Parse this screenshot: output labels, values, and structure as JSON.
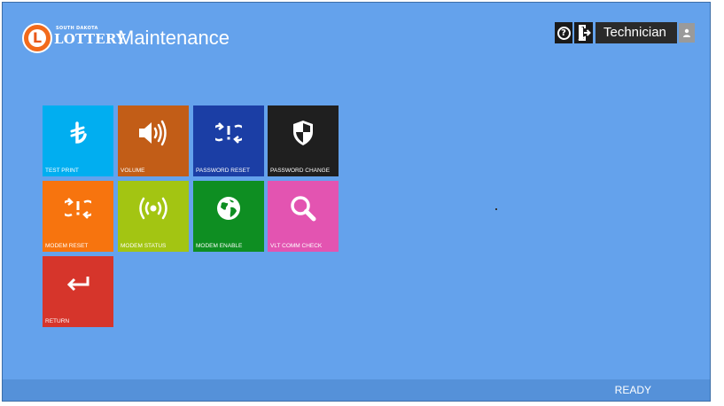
{
  "header": {
    "logo": {
      "sub": "SOUTH DAKOTA",
      "main": "LOTTERY",
      "letter": "L"
    },
    "title": "Maintenance",
    "user": "Technician"
  },
  "tiles": [
    {
      "label": "TEST PRINT",
      "icon": "test-print-icon",
      "color": "#01aef0"
    },
    {
      "label": "VOLUME",
      "icon": "speaker-icon",
      "color": "#c25d17"
    },
    {
      "label": "PASSWORD RESET",
      "icon": "reset-icon",
      "color": "#1b3ea5"
    },
    {
      "label": "PASSWORD CHANGE",
      "icon": "shield-icon",
      "color": "#1f1f1f"
    },
    {
      "label": "MODEM RESET",
      "icon": "reset-icon",
      "color": "#f7740e"
    },
    {
      "label": "MODEM STATUS",
      "icon": "signal-icon",
      "color": "#a3c512"
    },
    {
      "label": "MODEM ENABLE",
      "icon": "globe-icon",
      "color": "#0e8e22"
    },
    {
      "label": "VLT COMM CHECK",
      "icon": "search-icon",
      "color": "#e354b1"
    },
    {
      "label": "RETURN",
      "icon": "return-arrow-icon",
      "color": "#d6352b"
    }
  ],
  "status": "READY"
}
